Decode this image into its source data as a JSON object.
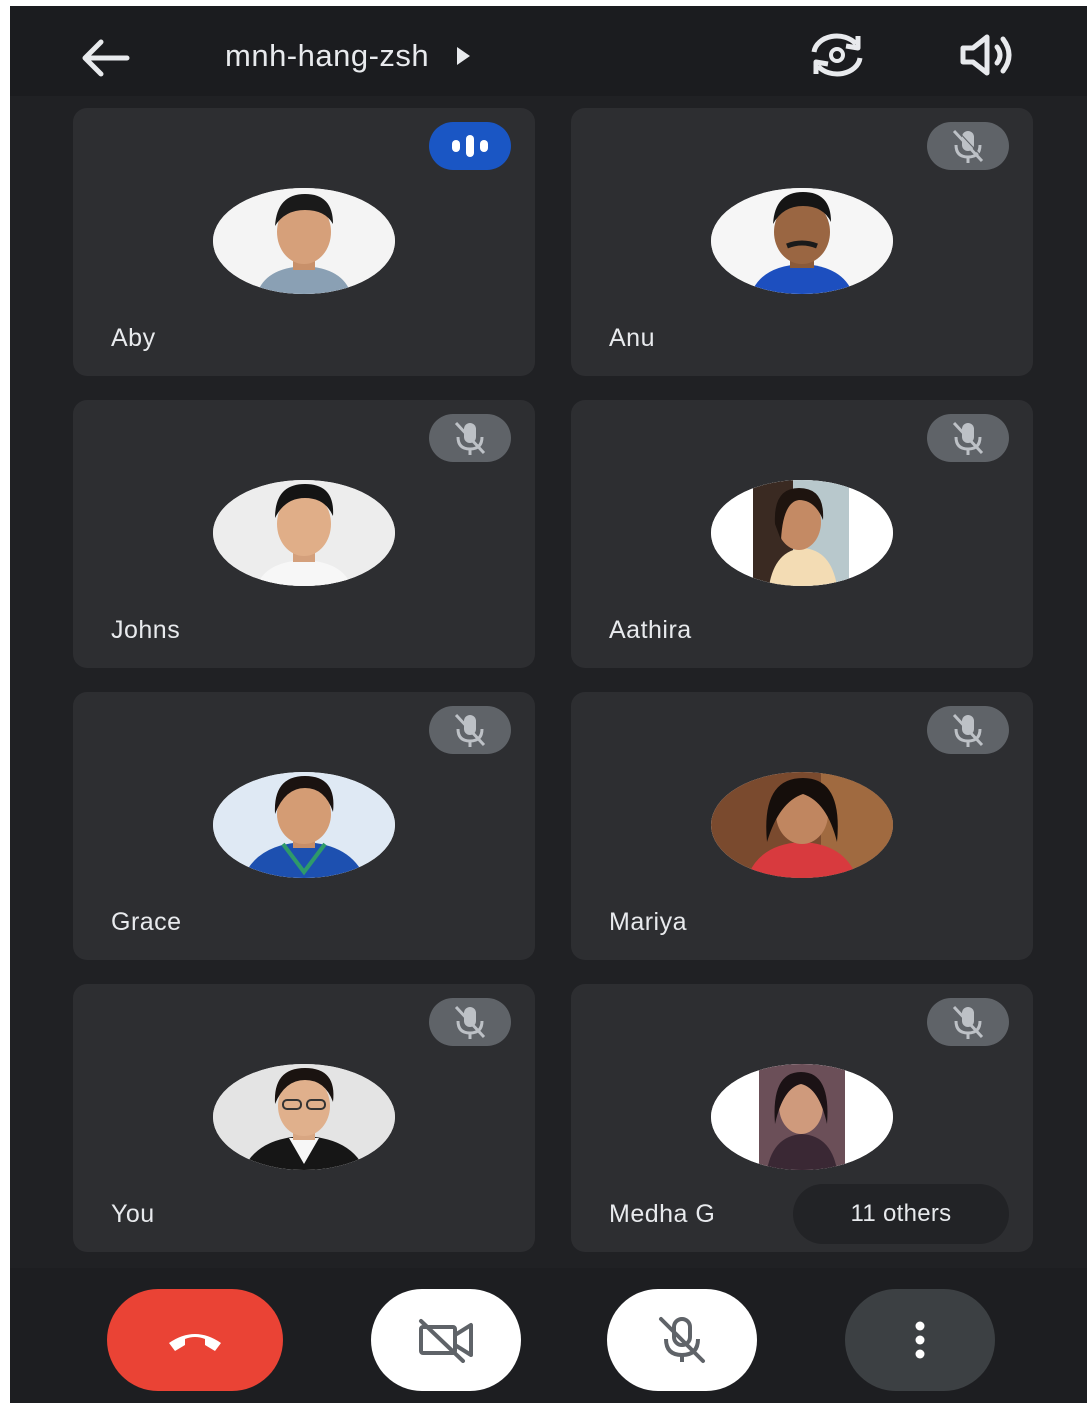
{
  "header": {
    "meeting_code": "mnh-hang-zsh",
    "icons": {
      "back": "arrow-back-icon",
      "title_chevron": "play-arrow-icon",
      "flip_camera": "flip-camera-icon",
      "speaker": "volume-icon"
    }
  },
  "participants": [
    {
      "name": "Aby",
      "status": "speaking"
    },
    {
      "name": "Anu",
      "status": "muted"
    },
    {
      "name": "Johns",
      "status": "muted"
    },
    {
      "name": "Aathira",
      "status": "muted"
    },
    {
      "name": "Grace",
      "status": "muted"
    },
    {
      "name": "Mariya",
      "status": "muted"
    },
    {
      "name": "You",
      "status": "muted"
    },
    {
      "name": "Medha G",
      "status": "muted"
    }
  ],
  "others_label": "11 others",
  "controls": {
    "end_call": "call-end-icon",
    "camera": "videocam-off-icon",
    "microphone": "mic-off-icon",
    "more": "more-vert-icon"
  },
  "colors": {
    "background": "#202124",
    "tile": "#2d2e31",
    "end_call": "#ea4335",
    "speaking": "#1a56c4",
    "muted_badge": "#5f6368"
  }
}
